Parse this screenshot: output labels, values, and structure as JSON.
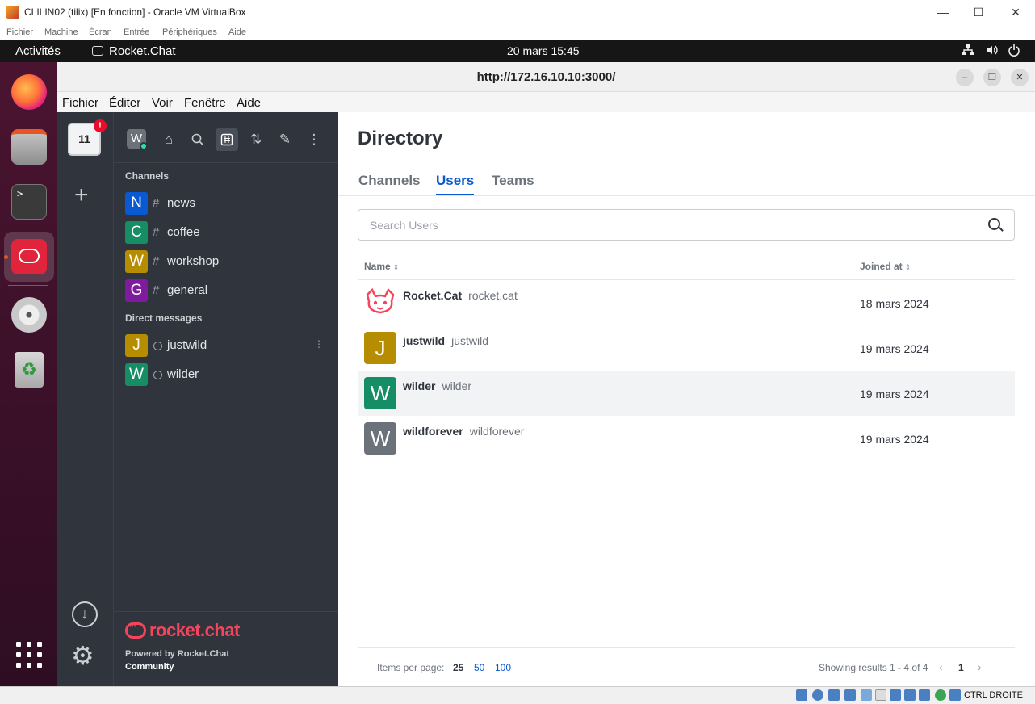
{
  "vbox": {
    "title": "CLILIN02 (tilix) [En fonction] - Oracle VM VirtualBox",
    "menu": [
      "Fichier",
      "Machine",
      "Écran",
      "Entrée",
      "Périphériques",
      "Aide"
    ],
    "host_key": "CTRL DROITE",
    "controls": {
      "minimize": "—",
      "maximize": "☐",
      "close": "✕"
    }
  },
  "ubuntu": {
    "activities": "Activités",
    "app_name": "Rocket.Chat",
    "clock": "20 mars  15:45"
  },
  "firefox": {
    "url": "http://172.16.10.10:3000/",
    "menu": [
      "Fichier",
      "Éditer",
      "Voir",
      "Fenêtre",
      "Aide"
    ]
  },
  "rail": {
    "workspace_label": "11",
    "alert": "!"
  },
  "sidebar": {
    "avatar_letter": "W",
    "channels_title": "Channels",
    "channels": [
      {
        "letter": "N",
        "name": "news",
        "color": "#095ad2"
      },
      {
        "letter": "C",
        "name": "coffee",
        "color": "#158d65"
      },
      {
        "letter": "W",
        "name": "workshop",
        "color": "#b68d00"
      },
      {
        "letter": "G",
        "name": "general",
        "color": "#7f1b9f"
      }
    ],
    "dm_title": "Direct messages",
    "dms": [
      {
        "letter": "J",
        "name": "justwild",
        "color": "#b68d00"
      },
      {
        "letter": "W",
        "name": "wilder",
        "color": "#158d65"
      }
    ],
    "powered_by": "Powered by Rocket.Chat",
    "community": "Community",
    "logo_text": "rocket.chat"
  },
  "directory": {
    "title": "Directory",
    "tabs": [
      "Channels",
      "Users",
      "Teams"
    ],
    "active_tab": "Users",
    "search_placeholder": "Search Users",
    "col_name": "Name",
    "col_joined": "Joined at",
    "users": [
      {
        "name": "Rocket.Cat",
        "username": "rocket.cat",
        "joined": "18 mars 2024",
        "avatar": "cat",
        "letter": "",
        "color": "#ffffff"
      },
      {
        "name": "justwild",
        "username": "justwild",
        "joined": "19 mars 2024",
        "avatar": "letter",
        "letter": "J",
        "color": "#b68d00"
      },
      {
        "name": "wilder",
        "username": "wilder",
        "joined": "19 mars 2024",
        "avatar": "letter",
        "letter": "W",
        "color": "#158d65"
      },
      {
        "name": "wildforever",
        "username": "wildforever",
        "joined": "19 mars 2024",
        "avatar": "letter",
        "letter": "W",
        "color": "#6c727a"
      }
    ],
    "items_per_page_label": "Items per page:",
    "per_page_options": [
      "25",
      "50",
      "100"
    ],
    "results_text": "Showing results 1 - 4 of 4",
    "current_page": "1"
  }
}
